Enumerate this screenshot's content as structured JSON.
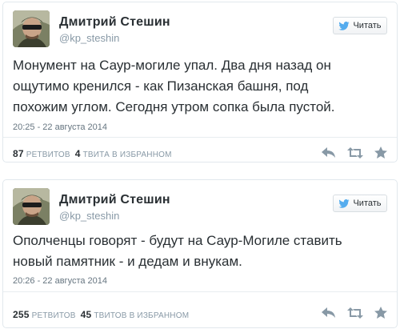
{
  "tweets": [
    {
      "author_name": "Дмитрий Стешин",
      "author_handle": "@kp_steshin",
      "follow_label": "Читать",
      "text": "Монумент на Саур-могиле упал. Два дня назад он\nощутимо кренился - как Пизанская башня, под\nпохожим углом. Сегодня утром сопка была пустой.",
      "timestamp": "20:25 - 22 августа 2014",
      "retweets_count": "87",
      "retweets_label": "РЕТВИТОВ",
      "favorites_count": "4",
      "favorites_label": "ТВИТА В ИЗБРАННОМ",
      "actions": [
        "reply-icon",
        "retweet-icon",
        "favorite-icon"
      ]
    },
    {
      "author_name": "Дмитрий Стешин",
      "author_handle": "@kp_steshin",
      "follow_label": "Читать",
      "text": "Ополченцы говорят - будут на Саур-Могиле ставить\nновый памятник - и дедам и внукам.",
      "timestamp": "20:26 - 22 августа 2014",
      "retweets_count": "255",
      "retweets_label": "РЕТВИТОВ",
      "favorites_count": "45",
      "favorites_label": "ТВИТОВ В ИЗБРАННОМ",
      "actions": [
        "reply-icon",
        "retweet-icon",
        "favorite-icon"
      ]
    }
  ],
  "colors": {
    "text": "#292f33",
    "muted": "#8899a6",
    "twitter_blue": "#55acee",
    "border": "#e1e8ed"
  }
}
